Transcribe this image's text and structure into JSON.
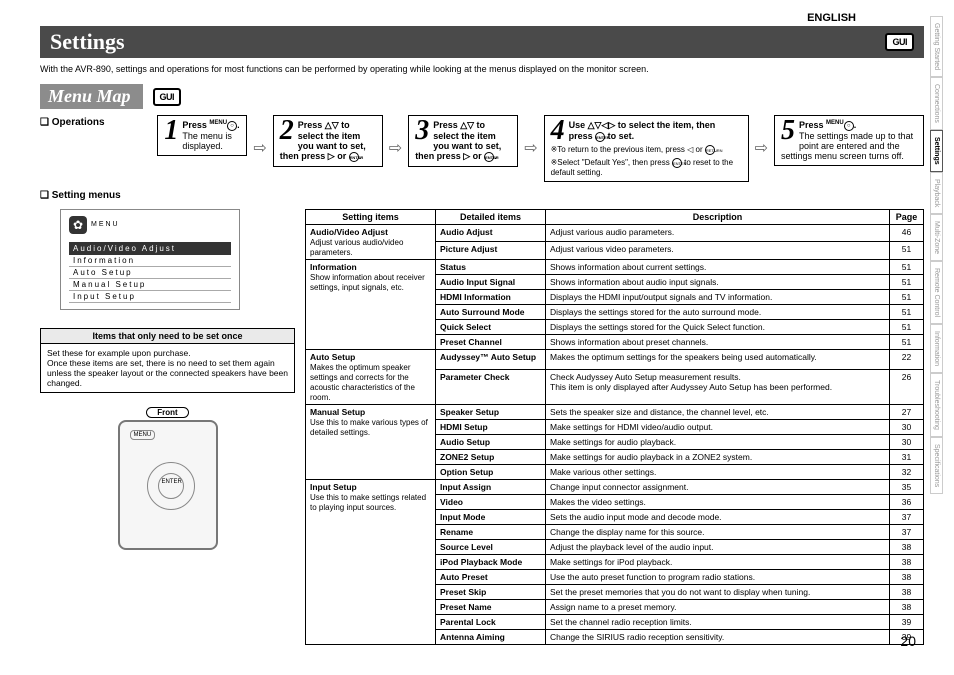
{
  "lang": "ENGLISH",
  "title": "Settings",
  "gui_label": "GUI",
  "intro": "With the AVR-890, settings and operations for most functions can be performed by operating while looking at the menus displayed on the monitor screen.",
  "menu_map": "Menu Map",
  "operations": "Operations",
  "setting_menus": "Setting menus",
  "steps": {
    "s1": {
      "num": "1",
      "body": "Press ",
      "tail": "The menu is displayed.",
      "menu_label": "MENU"
    },
    "s2": {
      "num": "2",
      "body": "Press △▽ to select the item you want to set, then press ▷ or ",
      "enter": "ENTER",
      "tail": "."
    },
    "s3": {
      "num": "3",
      "body": "Press △▽ to select the item you want to set, then press ▷ or ",
      "enter": "ENTER",
      "tail": "."
    },
    "s4": {
      "num": "4",
      "body": "Use △▽◁▷ to select the item, then press ",
      "enter": "ENTER",
      "tail": " to set.",
      "note1": "※To return to the previous item, press ◁ or ",
      "return": "RETURN",
      "note1b": ".",
      "note2": "※Select \"Default Yes\", then press ",
      "note2b": " to reset to the default setting."
    },
    "s5": {
      "num": "5",
      "body": "Press ",
      "menu_label": "MENU",
      "tail": "The settings made up to that point are entered and the settings menu screen turns off."
    }
  },
  "menu_box": {
    "title": "MENU",
    "highlight": "Audio/Video Adjust",
    "items": [
      "Information",
      "Auto Setup",
      "Manual Setup",
      "Input Setup"
    ]
  },
  "set_once": {
    "title": "Items that only need to be set once",
    "body": "Set these for example upon purchase.\nOnce these items are set, there is no need to set them again unless the speaker layout or the connected speakers have been changed."
  },
  "front_label": "Front",
  "table": {
    "headers": [
      "Setting items",
      "Detailed items",
      "Description",
      "Page"
    ],
    "groups": [
      {
        "setting": "Audio/Video Adjust",
        "desc": "Adjust various audio/video parameters.",
        "rows": [
          [
            "Audio Adjust",
            "Adjust various audio parameters.",
            "46"
          ],
          [
            "Picture Adjust",
            "Adjust various video parameters.",
            "51"
          ]
        ]
      },
      {
        "setting": "Information",
        "desc": "Show information about receiver settings, input signals, etc.",
        "rows": [
          [
            "Status",
            "Shows information about current settings.",
            "51"
          ],
          [
            "Audio Input Signal",
            "Shows information about audio input signals.",
            "51"
          ],
          [
            "HDMI Information",
            "Displays the HDMI input/output signals and TV information.",
            "51"
          ],
          [
            "Auto Surround Mode",
            "Displays the settings stored for the auto surround mode.",
            "51"
          ],
          [
            "Quick Select",
            "Displays the settings stored for the Quick Select function.",
            "51"
          ],
          [
            "Preset Channel",
            "Shows information about preset channels.",
            "51"
          ]
        ]
      },
      {
        "setting": "Auto Setup",
        "desc": "Makes the optimum speaker settings and corrects for the acoustic characteristics of the room.",
        "rows": [
          [
            "Audyssey™ Auto Setup",
            "Makes the optimum settings for the speakers being used automatically.",
            "22"
          ],
          [
            "Parameter Check",
            "Check Audyssey Auto Setup measurement results.\nThis item is only displayed after Audyssey Auto Setup has been performed.",
            "26"
          ]
        ]
      },
      {
        "setting": "Manual Setup",
        "desc": "Use this to make various types of detailed settings.",
        "rows": [
          [
            "Speaker Setup",
            "Sets the speaker size and distance, the channel level, etc.",
            "27"
          ],
          [
            "HDMI Setup",
            "Make settings for HDMI video/audio output.",
            "30"
          ],
          [
            "Audio Setup",
            "Make settings for audio playback.",
            "30"
          ],
          [
            "ZONE2 Setup",
            "Make settings for audio playback in a ZONE2 system.",
            "31"
          ],
          [
            "Option Setup",
            "Make various other settings.",
            "32"
          ]
        ]
      },
      {
        "setting": "Input Setup",
        "desc": "Use this to make settings related to playing input sources.",
        "rows": [
          [
            "Input Assign",
            "Change input connector assignment.",
            "35"
          ],
          [
            "Video",
            "Makes the video settings.",
            "36"
          ],
          [
            "Input Mode",
            "Sets the audio input mode and decode mode.",
            "37"
          ],
          [
            "Rename",
            "Change the display name for this source.",
            "37"
          ],
          [
            "Source Level",
            "Adjust the playback level of the audio input.",
            "38"
          ],
          [
            "iPod Playback Mode",
            "Make settings for iPod playback.",
            "38"
          ],
          [
            "Auto Preset",
            "Use the auto preset function to program radio stations.",
            "38"
          ],
          [
            "Preset Skip",
            "Set the preset memories that you do not want to display when tuning.",
            "38"
          ],
          [
            "Preset Name",
            "Assign name to a preset memory.",
            "38"
          ],
          [
            "Parental Lock",
            "Set the channel radio reception limits.",
            "39"
          ],
          [
            "Antenna Aiming",
            "Change the SIRIUS radio reception sensitivity.",
            "39"
          ]
        ]
      }
    ]
  },
  "tabs": [
    "Getting Started",
    "Connections",
    "Settings",
    "Playback",
    "Multi-Zone",
    "Remote Control",
    "Information",
    "Troubleshooting",
    "Specifications"
  ],
  "active_tab": 2,
  "page_number": "20"
}
